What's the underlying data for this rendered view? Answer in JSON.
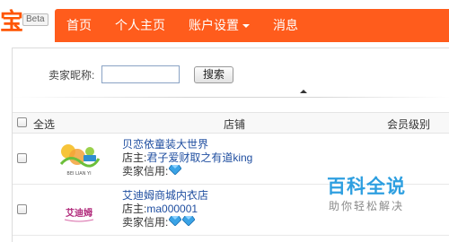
{
  "brand": {
    "logo_glyph": "宝",
    "badge": "Beta",
    "accent_color": "#ff5c1c"
  },
  "nav": {
    "items": [
      {
        "label": "首页"
      },
      {
        "label": "个人主页"
      },
      {
        "label": "账户设置",
        "has_dropdown": true
      },
      {
        "label": "消息"
      }
    ]
  },
  "search": {
    "label": "卖家昵称:",
    "input_value": "",
    "button_label": "搜索"
  },
  "table": {
    "headers": {
      "select_all": "全选",
      "shop": "店铺",
      "level": "会员级别"
    },
    "rows": [
      {
        "shop_name": "贝恋依童装大世界",
        "owner_label": "店主:",
        "owner_name": "君子爱财取之有道king",
        "credit_label": "卖家信用:",
        "credit_icon": "diamond-icon",
        "credit_count": 1,
        "logo_text": "BEI LIAN YI"
      },
      {
        "shop_name": "艾迪姆商城内衣店",
        "owner_label": "店主:",
        "owner_name": "ma000001",
        "credit_label": "卖家信用:",
        "credit_icon": "diamond-icon",
        "credit_count": 2,
        "logo_text": "艾迪姆"
      }
    ]
  },
  "watermark": {
    "title": "百科全说",
    "subtitle": "助你轻松解决"
  }
}
